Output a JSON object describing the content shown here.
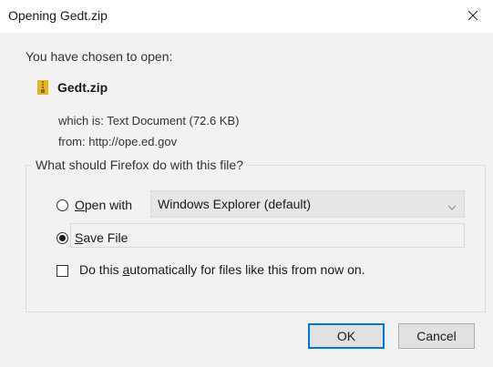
{
  "window": {
    "title": "Opening Gedt.zip",
    "close_icon": "close-icon"
  },
  "intro": {
    "chosen_label": "You have chosen to open:"
  },
  "file": {
    "icon": "zip-file-icon",
    "name": "Gedt.zip",
    "which_is": "which is:  Text Document (72.6 KB)",
    "from": "from:  http://ope.ed.gov"
  },
  "action_group": {
    "legend": "What should Firefox do with this file?",
    "open_with": {
      "accesskey": "O",
      "rest": "pen with",
      "selected": false
    },
    "open_with_select": {
      "value": "Windows Explorer (default)",
      "chevron_icon": "chevron-down-icon"
    },
    "save_file": {
      "accesskey": "S",
      "rest": "ave File",
      "selected": true
    },
    "auto_checkbox": {
      "before": "Do this ",
      "accesskey": "a",
      "after": "utomatically for files like this from now on.",
      "checked": false
    }
  },
  "buttons": {
    "ok_label": "OK",
    "cancel_label": "Cancel"
  },
  "colors": {
    "dialog_bg": "#f2f2f2",
    "titlebar_bg": "#ffffff",
    "focus_accent": "#0078d7",
    "zip_icon": "#e8b422"
  }
}
